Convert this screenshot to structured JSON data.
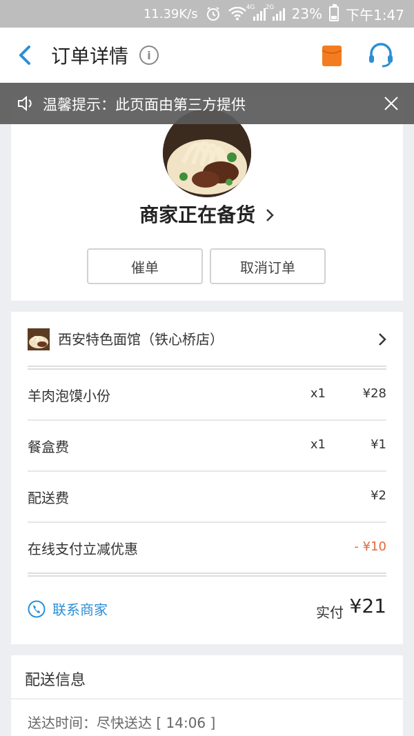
{
  "status_bar": {
    "net_speed": "11.39K/s",
    "net_4g": "4G",
    "net_2g": "2G",
    "battery": "23%",
    "time": "下午1:47"
  },
  "nav": {
    "title": "订单详情",
    "info_icon": "i"
  },
  "tip": {
    "text": "温馨提示：此页面由第三方提供"
  },
  "order_status": {
    "status_text": "商家正在备货",
    "urge_label": "催单",
    "cancel_label": "取消订单"
  },
  "shop": {
    "name": "西安特色面馆（铁心桥店）"
  },
  "items": [
    {
      "name": "羊肉泡馍小份",
      "qty": "x1",
      "price": "¥28"
    },
    {
      "name": "餐盒费",
      "qty": "x1",
      "price": "¥1"
    },
    {
      "name": "配送费",
      "qty": "",
      "price": "¥2"
    },
    {
      "name": "在线支付立减优惠",
      "qty": "",
      "price": "- ¥10"
    }
  ],
  "summary": {
    "contact_label": "联系商家",
    "paid_label": "实付",
    "paid_amount": "¥21"
  },
  "delivery": {
    "title": "配送信息",
    "time": "送达时间：尽快送达 [ 14:06 ]"
  },
  "colors": {
    "accent_blue": "#2a8fd6",
    "discount": "#e26a3b",
    "envelope_orange": "#f47c20"
  }
}
